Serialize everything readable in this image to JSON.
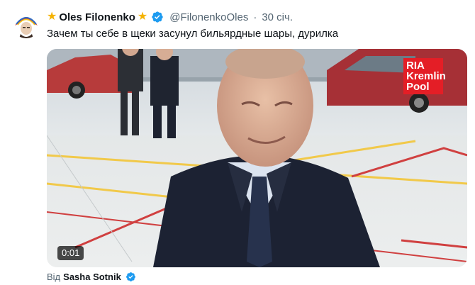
{
  "tweet": {
    "author_name": "Oles Filonenko",
    "name_prefix_emoji": "★",
    "name_suffix_emoji": "★",
    "handle": "@FilonenkoOles",
    "separator": "·",
    "time": "30 січ.",
    "text": "Зачем ты себе в щеки засунул бильярдные шары, дурилка",
    "media": {
      "type": "video",
      "duration": "0:01",
      "badge_lines": [
        "RIA",
        "Kremlin",
        "Pool"
      ]
    },
    "attribution": {
      "prefix": "Від",
      "author": "Sasha Sotnik"
    }
  },
  "colors": {
    "verified_blue": "#1d9bf0",
    "star": "#f5b301",
    "badge_red": "#e41e26",
    "secondary_text": "#536471"
  },
  "icons": {
    "verified": "verified-badge-icon",
    "star": "star-emoji"
  }
}
